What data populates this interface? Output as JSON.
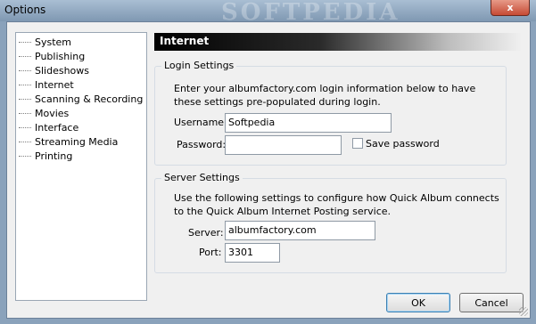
{
  "window": {
    "title": "Options",
    "watermark": "SOFTPEDIA",
    "close_label": "x"
  },
  "sidebar": {
    "items": [
      {
        "label": "System"
      },
      {
        "label": "Publishing"
      },
      {
        "label": "Slideshows"
      },
      {
        "label": "Internet"
      },
      {
        "label": "Scanning & Recording"
      },
      {
        "label": "Movies"
      },
      {
        "label": "Interface"
      },
      {
        "label": "Streaming Media"
      },
      {
        "label": "Printing"
      }
    ]
  },
  "panel": {
    "header": "Internet",
    "login": {
      "title": "Login Settings",
      "description": "Enter your albumfactory.com login information below to have these settings pre-populated during login.",
      "username_label": "Username:",
      "username_value": "Softpedia",
      "password_label": "Password:",
      "password_value": "",
      "save_password_label": "Save password"
    },
    "server": {
      "title": "Server Settings",
      "description": "Use the following settings to configure how Quick Album connects to the Quick Album Internet Posting service.",
      "server_label": "Server:",
      "server_value": "albumfactory.com",
      "port_label": "Port:",
      "port_value": "3301"
    }
  },
  "buttons": {
    "ok": "OK",
    "cancel": "Cancel"
  }
}
